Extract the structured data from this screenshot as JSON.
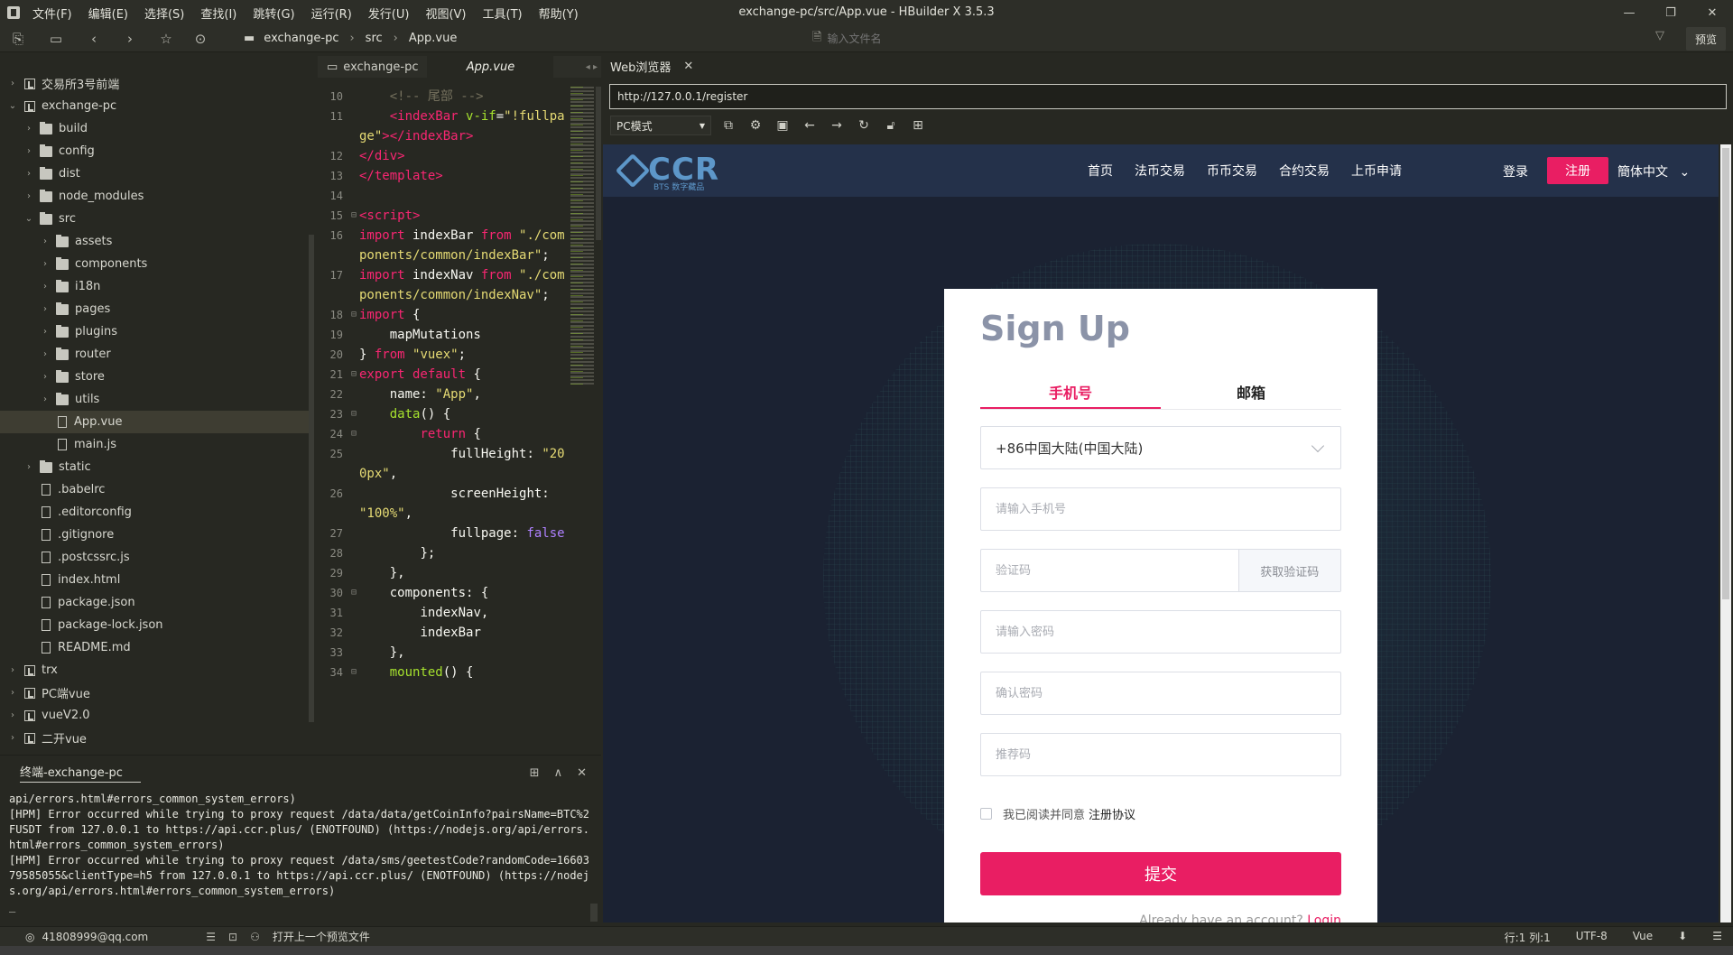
{
  "window": {
    "title": "exchange-pc/src/App.vue - HBuilder X 3.5.3",
    "menus": [
      "文件(F)",
      "编辑(E)",
      "选择(S)",
      "查找(I)",
      "跳转(G)",
      "运行(R)",
      "发行(U)",
      "视图(V)",
      "工具(T)",
      "帮助(Y)"
    ]
  },
  "toolbar": {
    "breadcrumbs": [
      "exchange-pc",
      "src",
      "App.vue"
    ],
    "file_search_placeholder": "输入文件名",
    "preview_label": "预览"
  },
  "tree": [
    {
      "label": "交易所3号前端",
      "indent": 0,
      "type": "proj",
      "chev": "›"
    },
    {
      "label": "exchange-pc",
      "indent": 0,
      "type": "proj",
      "chev": "⌄"
    },
    {
      "label": "build",
      "indent": 1,
      "type": "folder",
      "chev": "›"
    },
    {
      "label": "config",
      "indent": 1,
      "type": "folder",
      "chev": "›"
    },
    {
      "label": "dist",
      "indent": 1,
      "type": "folder",
      "chev": "›"
    },
    {
      "label": "node_modules",
      "indent": 1,
      "type": "folder",
      "chev": "›"
    },
    {
      "label": "src",
      "indent": 1,
      "type": "folder",
      "chev": "⌄"
    },
    {
      "label": "assets",
      "indent": 2,
      "type": "folder",
      "chev": "›"
    },
    {
      "label": "components",
      "indent": 2,
      "type": "folder",
      "chev": "›"
    },
    {
      "label": "i18n",
      "indent": 2,
      "type": "folder",
      "chev": "›"
    },
    {
      "label": "pages",
      "indent": 2,
      "type": "folder",
      "chev": "›"
    },
    {
      "label": "plugins",
      "indent": 2,
      "type": "folder",
      "chev": "›"
    },
    {
      "label": "router",
      "indent": 2,
      "type": "folder",
      "chev": "›"
    },
    {
      "label": "store",
      "indent": 2,
      "type": "folder",
      "chev": "›"
    },
    {
      "label": "utils",
      "indent": 2,
      "type": "folder",
      "chev": "›"
    },
    {
      "label": "App.vue",
      "indent": 2,
      "type": "file",
      "chev": "",
      "active": true
    },
    {
      "label": "main.js",
      "indent": 2,
      "type": "file",
      "chev": ""
    },
    {
      "label": "static",
      "indent": 1,
      "type": "folder",
      "chev": "›"
    },
    {
      "label": ".babelrc",
      "indent": 1,
      "type": "file",
      "chev": ""
    },
    {
      "label": ".editorconfig",
      "indent": 1,
      "type": "file",
      "chev": ""
    },
    {
      "label": ".gitignore",
      "indent": 1,
      "type": "file",
      "chev": ""
    },
    {
      "label": ".postcssrc.js",
      "indent": 1,
      "type": "file",
      "chev": ""
    },
    {
      "label": "index.html",
      "indent": 1,
      "type": "file",
      "chev": ""
    },
    {
      "label": "package.json",
      "indent": 1,
      "type": "file",
      "chev": ""
    },
    {
      "label": "package-lock.json",
      "indent": 1,
      "type": "file",
      "chev": ""
    },
    {
      "label": "README.md",
      "indent": 1,
      "type": "file",
      "chev": ""
    },
    {
      "label": "trx",
      "indent": 0,
      "type": "proj",
      "chev": "›"
    },
    {
      "label": "PC端vue",
      "indent": 0,
      "type": "proj",
      "chev": "›"
    },
    {
      "label": "vueV2.0",
      "indent": 0,
      "type": "proj",
      "chev": "›"
    },
    {
      "label": "二开vue",
      "indent": 0,
      "type": "proj",
      "chev": "›"
    }
  ],
  "editor": {
    "tabs": [
      "exchange-pc",
      "App.vue"
    ],
    "lines": [
      {
        "n": "10",
        "fold": "",
        "html": "    <span class='c'>&lt;!-- 尾部 --&gt;</span>"
      },
      {
        "n": "11",
        "fold": "",
        "html": "    <span class='t'>&lt;indexBar</span> <span class='a'>v-if</span>=<span class='s'>\"!fullpage\"</span><span class='t'>&gt;&lt;/indexBar&gt;</span>"
      },
      {
        "n": "12",
        "fold": "",
        "html": "<span class='t'>&lt;/div&gt;</span>"
      },
      {
        "n": "13",
        "fold": "",
        "html": "<span class='t'>&lt;/template&gt;</span>"
      },
      {
        "n": "14",
        "fold": "",
        "html": ""
      },
      {
        "n": "15",
        "fold": "⊟",
        "html": "<span class='t'>&lt;script&gt;</span>"
      },
      {
        "n": "16",
        "fold": "",
        "html": "<span class='k'>import</span> indexBar <span class='k'>from</span> <span class='s'>\"./components/common/indexBar\"</span>;"
      },
      {
        "n": "17",
        "fold": "",
        "html": "<span class='k'>import</span> indexNav <span class='k'>from</span> <span class='s'>\"./components/common/indexNav\"</span>;"
      },
      {
        "n": "18",
        "fold": "⊟",
        "html": "<span class='k'>import</span> {"
      },
      {
        "n": "19",
        "fold": "",
        "html": "    mapMutations"
      },
      {
        "n": "20",
        "fold": "",
        "html": "} <span class='k'>from</span> <span class='s'>\"vuex\"</span>;"
      },
      {
        "n": "21",
        "fold": "⊟",
        "html": "<span class='k'>export default</span> {"
      },
      {
        "n": "22",
        "fold": "",
        "html": "    name: <span class='s'>\"App\"</span>,"
      },
      {
        "n": "23",
        "fold": "⊟",
        "html": "    <span class='a'>data</span>() {"
      },
      {
        "n": "24",
        "fold": "⊟",
        "html": "        <span class='k'>return</span> {"
      },
      {
        "n": "25",
        "fold": "",
        "html": "            fullHeight: <span class='s'>\"200px\"</span>,"
      },
      {
        "n": "26",
        "fold": "",
        "html": "            screenHeight: <span class='s'>\"100%\"</span>,"
      },
      {
        "n": "27",
        "fold": "",
        "html": "            fullpage: <span class='b'>false</span>"
      },
      {
        "n": "28",
        "fold": "",
        "html": "        };"
      },
      {
        "n": "29",
        "fold": "",
        "html": "    },"
      },
      {
        "n": "30",
        "fold": "⊟",
        "html": "    components: {"
      },
      {
        "n": "31",
        "fold": "",
        "html": "        indexNav,"
      },
      {
        "n": "32",
        "fold": "",
        "html": "        indexBar"
      },
      {
        "n": "33",
        "fold": "",
        "html": "    },"
      },
      {
        "n": "34",
        "fold": "⊟",
        "html": "    <span class='a'>mounted</span>() {"
      }
    ]
  },
  "terminal": {
    "title": "终端-exchange-pc",
    "output": "api/errors.html#errors_common_system_errors)\n[HPM] Error occurred while trying to proxy request /data/data/getCoinInfo?pairsName=BTC%2FUSDT from 127.0.0.1 to https://api.ccr.plus/ (ENOTFOUND) (https://nodejs.org/api/errors.html#errors_common_system_errors)\n[HPM] Error occurred while trying to proxy request /data/sms/geetestCode?randomCode=1660379585055&clientType=h5 from 127.0.0.1 to https://api.ccr.plus/ (ENOTFOUND) (https://nodejs.org/api/errors.html#errors_common_system_errors)\n_"
  },
  "browser": {
    "tab_label": "Web浏览器",
    "url": "http://127.0.0.1/register",
    "mode": "PC模式"
  },
  "site": {
    "logo_text": "CCR",
    "logo_sub": "BTS 数字藏品",
    "nav_links": [
      "首页",
      "法币交易",
      "币币交易",
      "合约交易",
      "上币申请"
    ],
    "login": "登录",
    "register": "注册",
    "language": "簡体中文",
    "form": {
      "title": "Sign Up",
      "tabs": [
        "手机号",
        "邮箱"
      ],
      "country": "+86中国大陆(中国大陆)",
      "phone_placeholder": "请输入手机号",
      "code_placeholder": "验证码",
      "get_code": "获取验证码",
      "password_placeholder": "请输入密码",
      "confirm_placeholder": "确认密码",
      "referral_placeholder": "推荐码",
      "agree_text": "我已阅读并同意",
      "agree_link": "注册协议",
      "submit": "提交",
      "have_account": "Already have an account?",
      "login_link": "Login"
    },
    "colors": {
      "accent": "#e91e63",
      "nav_bg": "#24314a",
      "page_bg": "#1b2232"
    }
  },
  "statusbar": {
    "user": "41808999@qq.com",
    "last_preview": "打开上一个预览文件",
    "position": "行:1   列:1",
    "encoding": "UTF-8",
    "lang": "Vue"
  }
}
